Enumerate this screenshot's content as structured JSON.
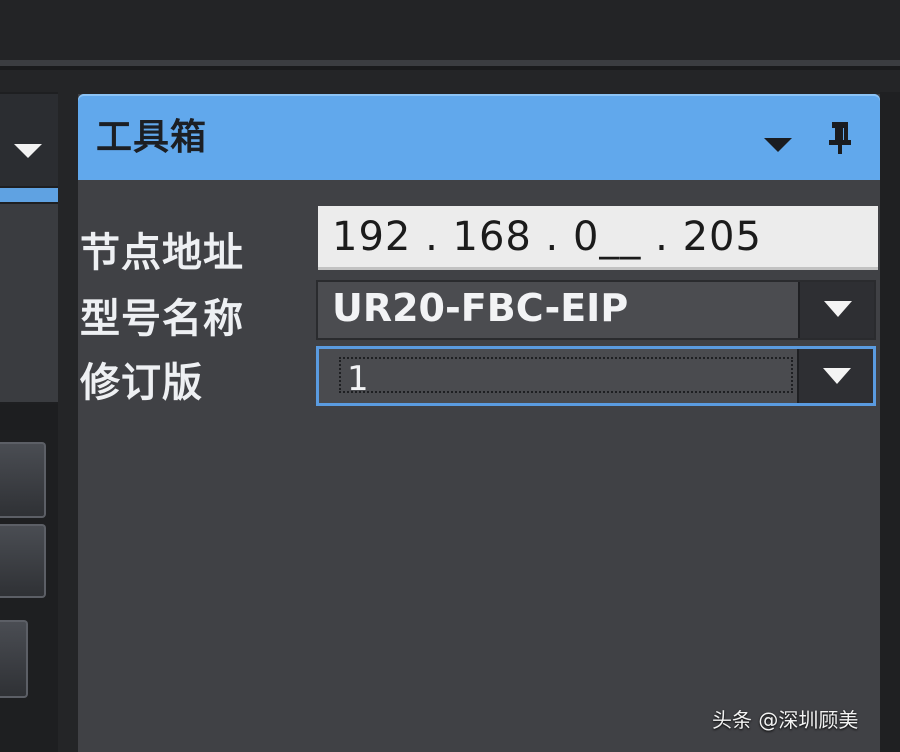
{
  "toolbox": {
    "title": "工具箱",
    "fields": {
      "node_address_label": "节点地址",
      "node_address_value": "192 . 168 . 0__ . 205",
      "model_name_label": "型号名称",
      "model_name_value": "UR20-FBC-EIP",
      "revision_label": "修订版",
      "revision_value": "1"
    }
  },
  "watermark": "头条 @深圳顾美",
  "colors": {
    "header_blue": "#61a8ec",
    "panel_gray": "#404145",
    "accent_blue": "#5fa2e2"
  },
  "icons": [
    "dropdown-icon",
    "pin-icon"
  ]
}
